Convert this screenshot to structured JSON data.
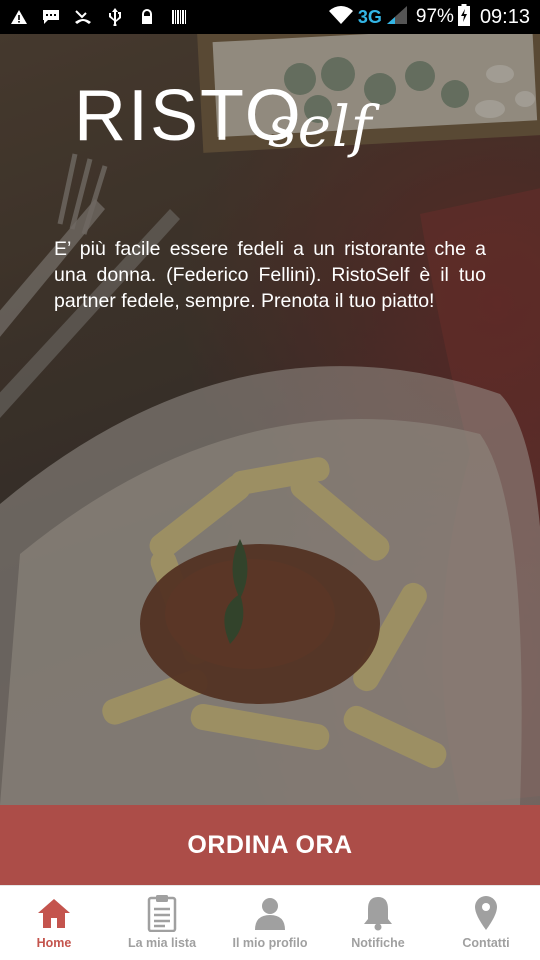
{
  "status_bar": {
    "network_type": "3G",
    "battery_percent": "97%",
    "time": "09:13",
    "icons": [
      "warning-icon",
      "chat-icon",
      "missed-call-icon",
      "usb-icon",
      "lock-icon",
      "barcode-icon",
      "wifi-icon",
      "signal-icon",
      "battery-charging-icon"
    ]
  },
  "logo": {
    "main": "RISTO",
    "script": "self"
  },
  "quote": "E’ più facile essere fedeli a un ristorante che a una donna. (Federico Fellini). RistoSelf è il tuo partner fedele, sempre. Prenota il tuo piatto!",
  "cta": {
    "label": "ORDINA ORA"
  },
  "bottom_nav": {
    "items": [
      {
        "label": "Home",
        "icon": "home-icon",
        "active": true
      },
      {
        "label": "La mia lista",
        "icon": "clipboard-icon",
        "active": false
      },
      {
        "label": "Il mio profilo",
        "icon": "user-icon",
        "active": false
      },
      {
        "label": "Notifiche",
        "icon": "bell-icon",
        "active": false
      },
      {
        "label": "Contatti",
        "icon": "location-pin-icon",
        "active": false
      }
    ]
  },
  "colors": {
    "accent": "#c4544d",
    "cta_background": "#c45852",
    "inactive_nav": "#a0a0a0",
    "network_type": "#33b5e5"
  }
}
